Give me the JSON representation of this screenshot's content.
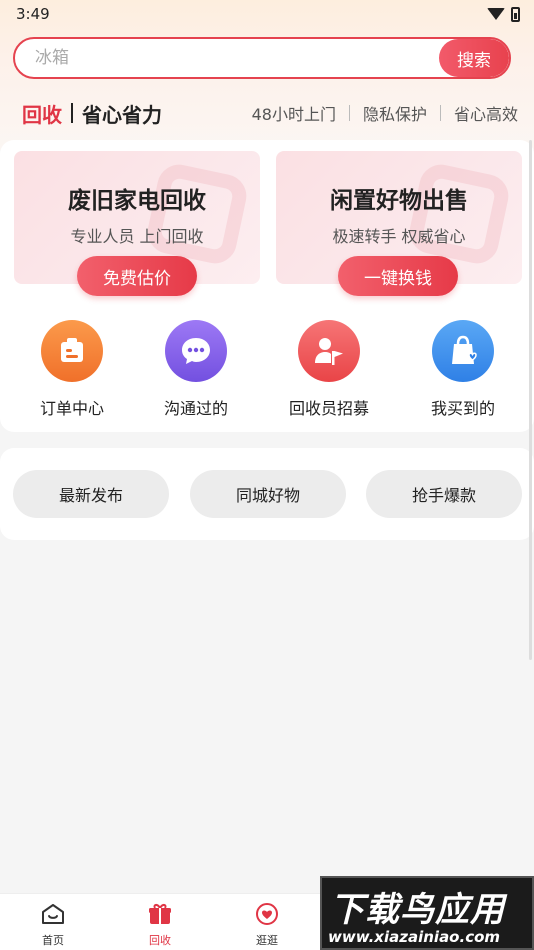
{
  "status_bar": {
    "time": "3:49"
  },
  "search": {
    "placeholder": "冰箱",
    "button_label": "搜索"
  },
  "slogan": {
    "brand": "回收",
    "tagline": "省心省力",
    "features": [
      "48小时上门",
      "隐私保护",
      "省心高效"
    ]
  },
  "cards": [
    {
      "title": "废旧家电回收",
      "subtitle": "专业人员 上门回收",
      "button": "免费估价"
    },
    {
      "title": "闲置好物出售",
      "subtitle": "极速转手 权威省心",
      "button": "一键换钱"
    }
  ],
  "quick_links": [
    {
      "label": "订单中心",
      "icon": "order-icon",
      "color": "#f57a2c"
    },
    {
      "label": "沟通过的",
      "icon": "chat-icon",
      "color": "#8a63e8"
    },
    {
      "label": "回收员招募",
      "icon": "recruit-icon",
      "color": "#ef5557"
    },
    {
      "label": "我买到的",
      "icon": "bag-icon",
      "color": "#3f93ec"
    }
  ],
  "filters": [
    "最新发布",
    "同城好物",
    "抢手爆款"
  ],
  "bottom_nav": [
    {
      "label": "首页",
      "icon": "home-icon"
    },
    {
      "label": "回收",
      "icon": "gift-icon"
    },
    {
      "label": "逛逛",
      "icon": "heart-icon"
    }
  ],
  "watermark": {
    "title": "下载鸟应用",
    "url": "www.xiazainiao.com"
  },
  "colors": {
    "accent": "#e5434f",
    "pill_bg": "#ececec"
  }
}
